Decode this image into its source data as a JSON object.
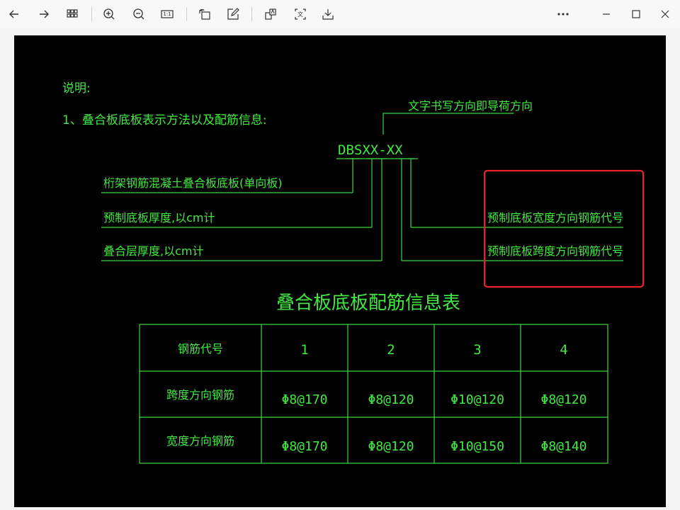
{
  "toolbar": {
    "back_icon": "arrow-left-icon",
    "forward_icon": "arrow-right-icon",
    "grid_icon": "grid-view-icon",
    "zoom_in_icon": "zoom-in-icon",
    "zoom_out_icon": "zoom-out-icon",
    "actual_size_label": "1:1",
    "rotate_icon": "rotate-icon",
    "edit_icon": "edit-icon",
    "translate_icon": "translate-icon",
    "ocr_label": "文",
    "save_icon": "download-icon",
    "more_icon": "more-icon",
    "minimize_icon": "minimize-icon",
    "maximize_icon": "maximize-icon",
    "close_icon": "close-icon"
  },
  "drawing": {
    "note_title": "说明:",
    "note_line1": "1、叠合板底板表示方法以及配筋信息:",
    "code": "DBSXX-XX",
    "direction_label": "文字书写方向即导荷方向",
    "left_labels": [
      "桁架钢筋混凝土叠合板底板(单向板)",
      "预制底板厚度,以cm计",
      "叠合层厚度,以cm计"
    ],
    "right_labels": [
      "预制底板宽度方向钢筋代号",
      "预制底板跨度方向钢筋代号"
    ],
    "table_title": "叠合板底板配筋信息表",
    "table": {
      "header": [
        "钢筋代号",
        "1",
        "2",
        "3",
        "4"
      ],
      "rows": [
        [
          "跨度方向钢筋",
          "Φ8@170",
          "Φ8@120",
          "Φ10@120",
          "Φ8@120"
        ],
        [
          "宽度方向钢筋",
          "Φ8@170",
          "Φ8@120",
          "Φ10@150",
          "Φ8@140"
        ]
      ]
    },
    "highlight_color": "#e8232a",
    "line_color": "#43e843"
  }
}
